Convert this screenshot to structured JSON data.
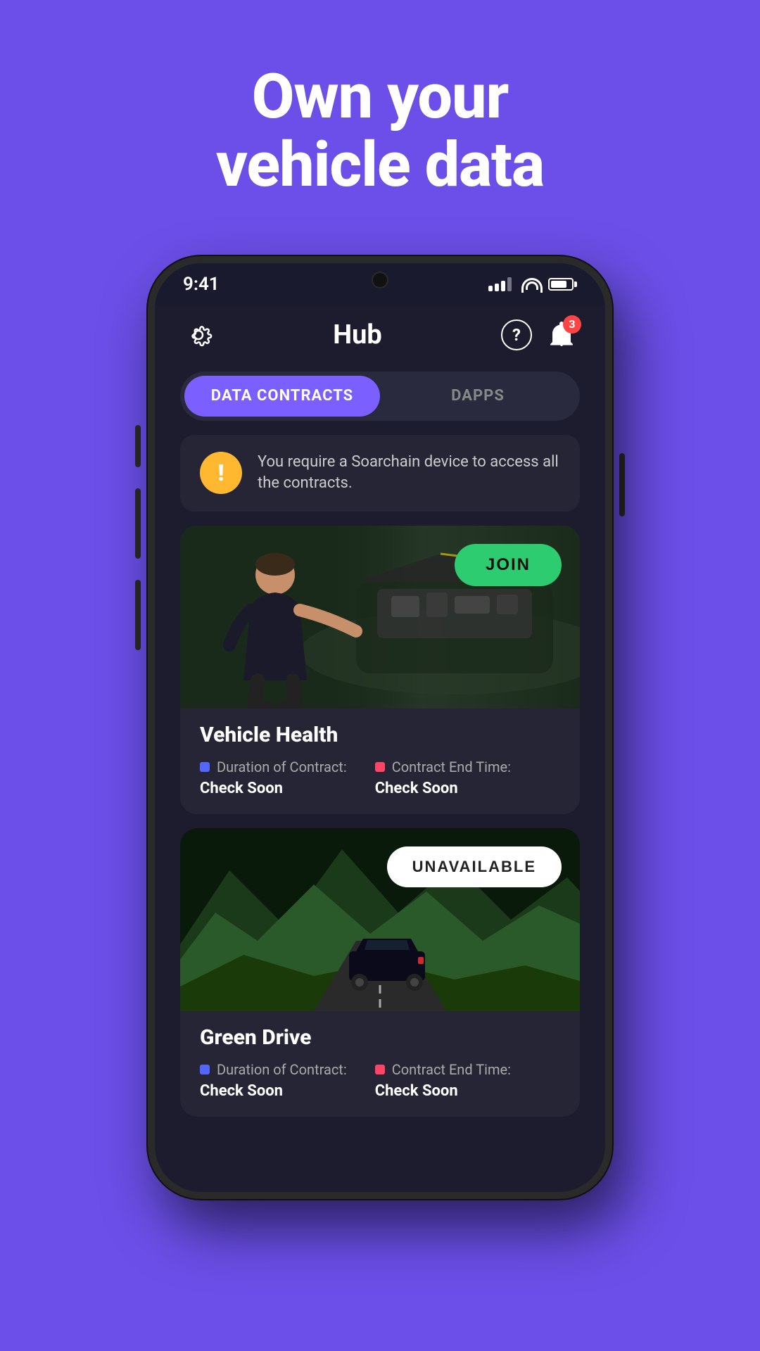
{
  "hero": {
    "line1": "Own your",
    "line2": "vehicle data"
  },
  "phone": {
    "status": {
      "time": "9:41",
      "notification_count": "3"
    },
    "header": {
      "title": "Hub"
    },
    "tabs": [
      {
        "id": "data-contracts",
        "label": "DATA CONTRACTS",
        "active": true
      },
      {
        "id": "dapps",
        "label": "DAPPS",
        "active": false
      }
    ],
    "warning": {
      "text": "You require a Soarchain device to access all the contracts."
    },
    "contracts": [
      {
        "id": "vehicle-health",
        "title": "Vehicle Health",
        "action": "JOIN",
        "action_style": "join",
        "duration_label": "Duration of Contract:",
        "duration_value": "Check Soon",
        "end_time_label": "Contract End Time:",
        "end_time_value": "Check Soon"
      },
      {
        "id": "green-drive",
        "title": "Green Drive",
        "action": "UNAVAILABLE",
        "action_style": "unavailable",
        "duration_label": "Duration of Contract:",
        "duration_value": "Check Soon",
        "end_time_label": "Contract End Time:",
        "end_time_value": "Check Soon"
      }
    ]
  },
  "colors": {
    "background": "#6B4FE8",
    "accent_purple": "#7B5FFF",
    "accent_green": "#2ECC71",
    "card_bg": "#252535",
    "warning_yellow": "#FFB830"
  }
}
